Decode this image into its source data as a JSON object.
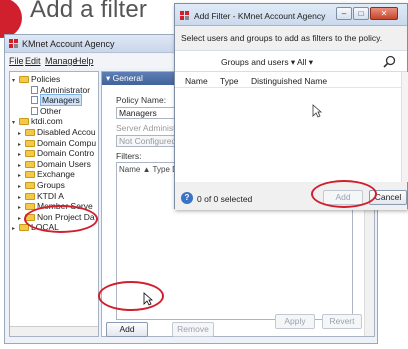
{
  "heading": {
    "text": "Add a filter"
  },
  "colors": {
    "accent": "#d0202e",
    "section_header": "#4a6aa3"
  },
  "main": {
    "title": "KMnet Account Agency",
    "menu": [
      "File",
      "Edit",
      "Manage",
      "Help"
    ],
    "tree": [
      {
        "label": "Policies",
        "indent": 0,
        "icon": "folder-icon",
        "twisty": "▾"
      },
      {
        "label": "Administrator",
        "indent": 2,
        "icon": "document-icon",
        "twisty": ""
      },
      {
        "label": "Managers",
        "indent": 2,
        "icon": "document-icon",
        "twisty": "",
        "selected": true
      },
      {
        "label": "Other",
        "indent": 2,
        "icon": "document-icon",
        "twisty": ""
      },
      {
        "label": "ktdi.com",
        "indent": 0,
        "icon": "folder-icon",
        "twisty": "▾"
      },
      {
        "label": "Disabled Accou",
        "indent": 1,
        "icon": "folder-icon",
        "twisty": "▸"
      },
      {
        "label": "Domain Compu",
        "indent": 1,
        "icon": "folder-icon",
        "twisty": "▸"
      },
      {
        "label": "Domain Contro",
        "indent": 1,
        "icon": "folder-icon",
        "twisty": "▸"
      },
      {
        "label": "Domain Users",
        "indent": 1,
        "icon": "folder-icon",
        "twisty": "▸"
      },
      {
        "label": "Exchange",
        "indent": 1,
        "icon": "folder-icon",
        "twisty": "▸"
      },
      {
        "label": "Groups",
        "indent": 1,
        "icon": "folder-icon",
        "twisty": "▸"
      },
      {
        "label": "KTDI A",
        "indent": 1,
        "icon": "folder-icon",
        "twisty": "▸"
      },
      {
        "label": "Member Serve",
        "indent": 1,
        "icon": "folder-icon",
        "twisty": "▸"
      },
      {
        "label": "Non Project Da",
        "indent": 1,
        "icon": "folder-icon",
        "twisty": "▸"
      },
      {
        "label": "LOCAL",
        "indent": 0,
        "icon": "folder-icon",
        "twisty": "▸"
      }
    ],
    "section_title": "General",
    "policy_name_label": "Policy Name:",
    "policy_name_value": "Managers",
    "server_admin_label": "Server Administration",
    "server_admin_value": "Not Configured",
    "filters_label": "Filters:",
    "filters_columns": "Name ▲  Type Distin",
    "add_button": "Add",
    "remove_button": "Remove",
    "apply_button": "Apply",
    "revert_button": "Revert"
  },
  "dialog": {
    "title": "Add Filter - KMnet Account Agency",
    "instruction": "Select users and groups to add as filters to the policy.",
    "type_filter": "Groups and users ▾",
    "scope_filter": "All  ▾",
    "columns": [
      "Name",
      "Type",
      "Distinguished Name"
    ],
    "status": "0 of 0 selected",
    "add_button": "Add",
    "cancel_button": "Cancel"
  }
}
